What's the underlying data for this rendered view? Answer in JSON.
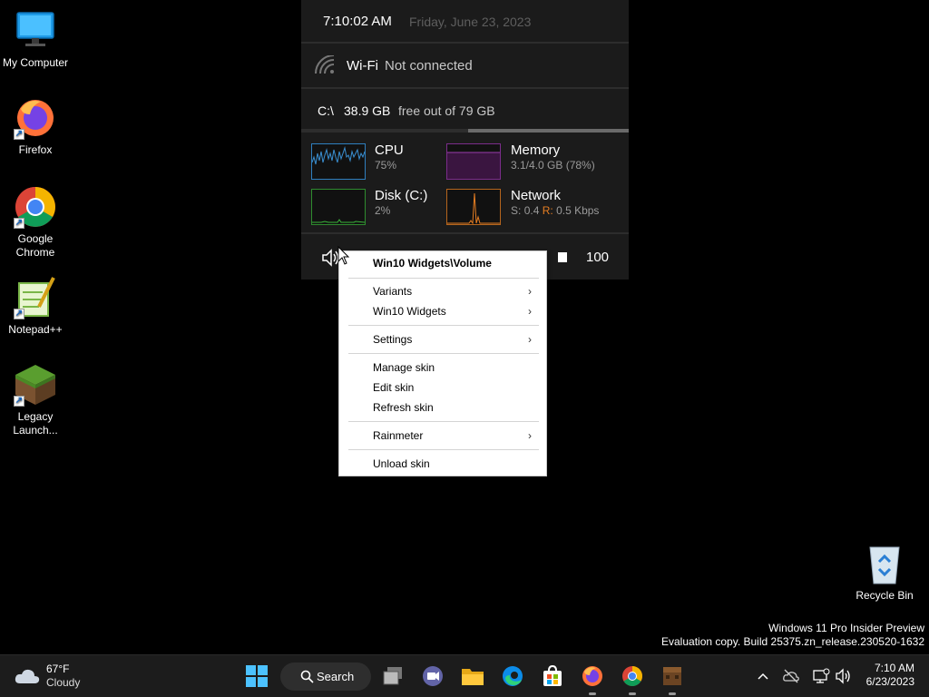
{
  "desktop_icons": [
    {
      "label": "My Computer"
    },
    {
      "label": "Firefox"
    },
    {
      "label": "Google Chrome"
    },
    {
      "label": "Notepad++"
    },
    {
      "label": "Legacy Launch..."
    },
    {
      "label": "Recycle Bin"
    }
  ],
  "widget": {
    "time": "7:10:02 AM",
    "date": "Friday, June 23, 2023",
    "wifi_label": "Wi-Fi",
    "wifi_status": "Not connected",
    "drive_letter": "C:\\",
    "drive_free": "38.9 GB",
    "drive_desc": "free out of 79 GB",
    "drive_used_fraction": 0.51,
    "cpu": {
      "name": "CPU",
      "value": "75%"
    },
    "memory": {
      "name": "Memory",
      "value": "3.1/4.0 GB (78%)"
    },
    "disk": {
      "name": "Disk (C:)",
      "value": "2%"
    },
    "network": {
      "name": "Network",
      "send_label": "S:",
      "send_value": "0.4",
      "recv_label": "R:",
      "recv_value": "0.5 Kbps"
    },
    "volume": "100",
    "colors": {
      "cpu": "#3a8fd1",
      "memory": "#7b2d8b",
      "disk": "#2e8b2e",
      "network": "#d2691e"
    }
  },
  "context_menu": {
    "title": "Win10 Widgets\\Volume",
    "items": [
      {
        "label": "Variants",
        "submenu": true
      },
      {
        "label": "Win10 Widgets",
        "submenu": true
      },
      {
        "label": "Settings",
        "submenu": true
      },
      {
        "label": "Manage skin",
        "submenu": false
      },
      {
        "label": "Edit skin",
        "submenu": false
      },
      {
        "label": "Refresh skin",
        "submenu": false
      },
      {
        "label": "Rainmeter",
        "submenu": true
      },
      {
        "label": "Unload skin",
        "submenu": false
      }
    ],
    "arrow": "›"
  },
  "watermark": {
    "line1": "Windows 11 Pro Insider Preview",
    "line2": "Evaluation copy. Build 25375.zn_release.230520-1632"
  },
  "taskbar": {
    "weather_temp": "67°F",
    "weather_desc": "Cloudy",
    "search_label": "Search",
    "apps": [
      "start-icon",
      "task-view-icon",
      "teams-chat-icon",
      "file-explorer-icon",
      "edge-icon",
      "store-icon",
      "firefox-icon",
      "chrome-icon",
      "minecraft-icon"
    ],
    "clock_time": "7:10 AM",
    "clock_date": "6/23/2023"
  }
}
